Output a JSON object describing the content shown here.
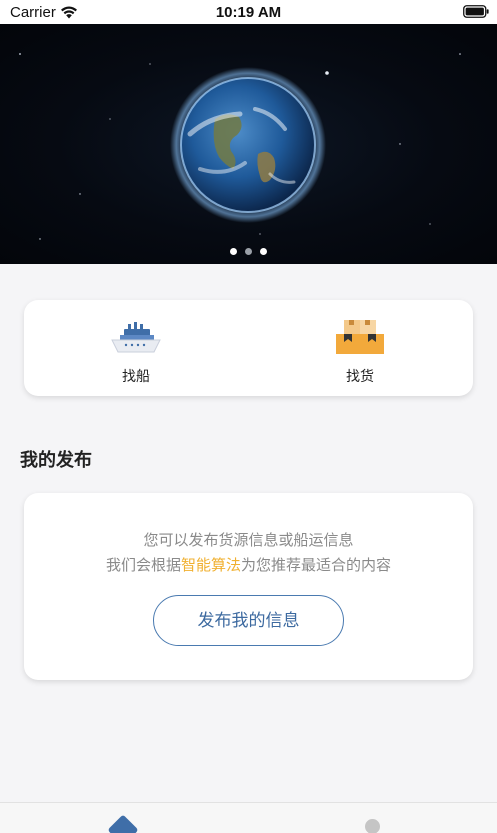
{
  "status_bar": {
    "carrier": "Carrier",
    "time": "10:19 AM"
  },
  "banner": {
    "image": "earth-from-space",
    "dots": [
      {
        "active": true
      },
      {
        "active": false
      },
      {
        "active": true
      }
    ]
  },
  "entries": [
    {
      "label": "找船",
      "icon": "ship-icon"
    },
    {
      "label": "找货",
      "icon": "cargo-boxes-icon"
    }
  ],
  "section": {
    "title": "我的发布"
  },
  "publish": {
    "line1": "您可以发布货源信息或船运信息",
    "line2_prefix": "我们会根据",
    "line2_highlight": "智能算法",
    "line2_suffix": "为您推荐最适合的内容",
    "button_label": "发布我的信息"
  },
  "tabbar": {
    "tabs": [
      {
        "icon": "home-diamond-icon"
      },
      {
        "icon": "profile-icon"
      }
    ]
  },
  "colors": {
    "accent": "#3f6ea8",
    "highlight": "#f0b030",
    "muted_text": "#8a8a8a",
    "background": "#f5f5f7"
  }
}
